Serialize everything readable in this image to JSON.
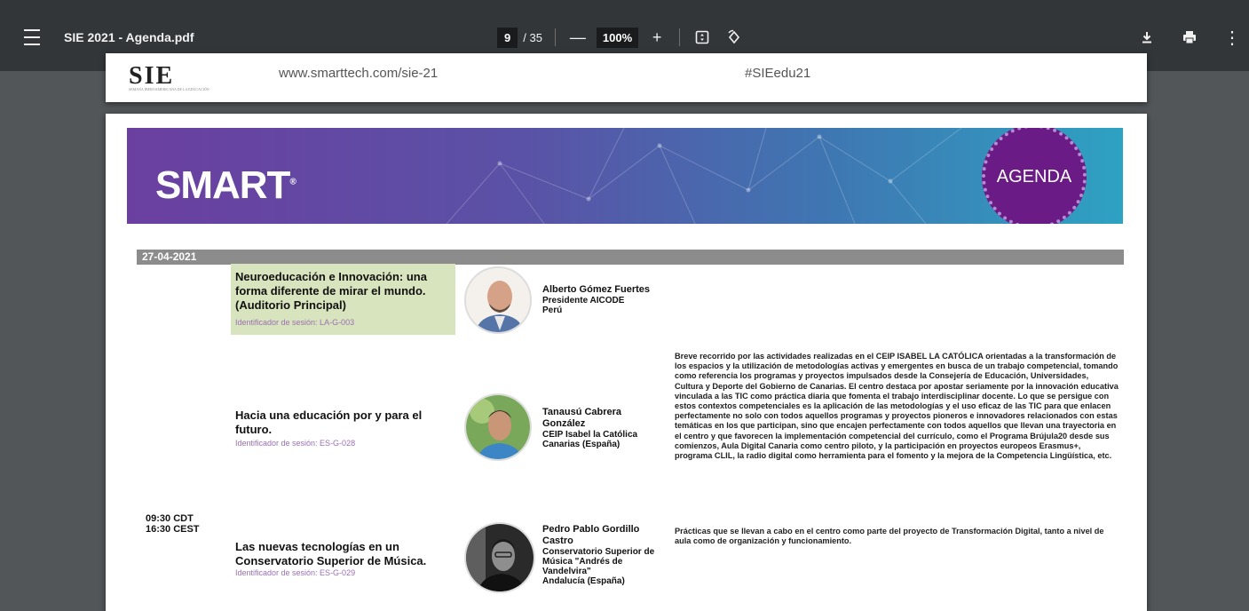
{
  "toolbar": {
    "title": "SIE 2021 - Agenda.pdf",
    "current_page": "9",
    "total_pages": "/ 35",
    "zoom": "100%",
    "icons": [
      "menu-icon",
      "zoom-out-icon",
      "zoom-in-icon",
      "fit-page-icon",
      "rotate-icon",
      "download-icon",
      "print-icon",
      "more-icon"
    ]
  },
  "page1": {
    "logo": "SIE",
    "url": "www.smarttech.com/sie-21",
    "hashtag": "#SIEedu21"
  },
  "banner": {
    "logo": "SMART",
    "badge": "AGENDA"
  },
  "agenda": {
    "date": "27-04-2021",
    "time_line1": "09:30 CDT",
    "time_line2": "16:30 CEST",
    "sessions": [
      {
        "title": "Neuroeducación e Innovación: una forma diferente de mirar el mundo. (Auditorio Principal)",
        "id": "Identificador de sesión: LA-G-003",
        "speaker_name": "Alberto Gómez Fuertes",
        "speaker_role": "Presidente AICODE",
        "speaker_place": "Perú",
        "description": ""
      },
      {
        "title": "Hacia una educación por y para el futuro.",
        "id": "Identificador de sesión: ES-G-028",
        "speaker_name": "Tanausú Cabrera González",
        "speaker_role": "CEIP Isabel la Católica",
        "speaker_place": "Canarias (España)",
        "description": "Breve recorrido por las actividades realizadas en el CEIP ISABEL LA CATÓLICA orientadas a la transformación de los espacios y la utilización de metodologías activas y emergentes en busca de un trabajo competencial, tomando como referencia los programas y proyectos impulsados desde la Consejería de Educación, Universidades, Cultura y Deporte del Gobierno de Canarias. El centro destaca por apostar seriamente por la innovación educativa vinculada a las TIC como práctica diaria que fomenta el trabajo interdisciplinar docente. Lo que se persigue con estos contextos competenciales es la aplicación de las metodologías y el uso eficaz de las TIC para que enlacen perfectamente no solo con todos aquellos programas y proyectos pioneros e innovadores relacionados con estas temáticas en los que participan, sino que encajen perfectamente con todos aquellos que llevan una trayectoria en el centro y que favorecen la implementación competencial del currículo, como el Programa Brújula20 desde sus comienzos, Aula Digital Canaria como centro piloto, y la participación en proyectos europeos Erasmus+, programa CLIL, la radio digital como herramienta para el fomento y la mejora de la Competencia Lingüística, etc."
      },
      {
        "title": "Las nuevas tecnologías en un Conservatorio Superior de Música.",
        "id": "Identificador de sesión: ES-G-029",
        "speaker_name": "Pedro Pablo Gordillo Castro",
        "speaker_role": "Conservatorio Superior de Música \"Andrés de Vandelvira\"",
        "speaker_place": "Andalucía (España)",
        "description": "Prácticas que se llevan a cabo en el centro como parte del proyecto de Transformación Digital, tanto a nivel de aula como de organización y funcionamiento."
      }
    ]
  }
}
